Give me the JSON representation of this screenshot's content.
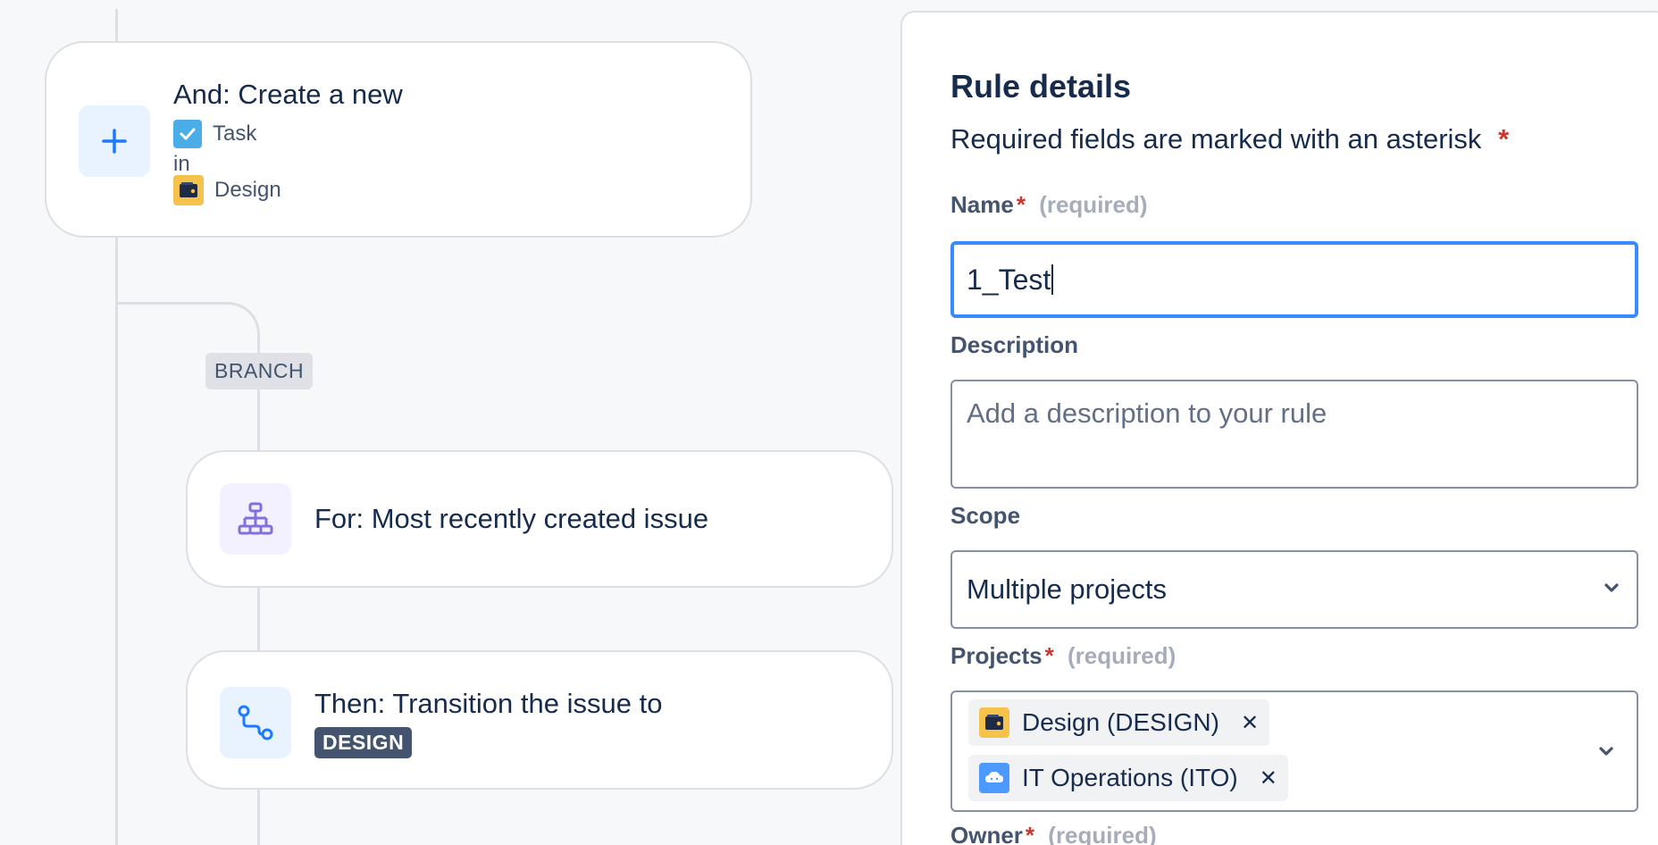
{
  "canvas": {
    "trigger_card": {
      "title": "And: Create a new",
      "issue_type": "Task",
      "in_label": "in",
      "project": "Design",
      "icon": "plus-icon"
    },
    "branch_label": "BRANCH",
    "for_card": {
      "title": "For: Most recently created issue",
      "icon": "hierarchy-icon"
    },
    "then_card": {
      "title": "Then: Transition the issue to",
      "status": "DESIGN",
      "icon": "transition-icon"
    }
  },
  "panel": {
    "title": "Rule details",
    "required_note": "Required fields are marked with an asterisk",
    "asterisk": "*",
    "name": {
      "label": "Name",
      "hint": "(required)",
      "value": "1_Test"
    },
    "description": {
      "label": "Description",
      "placeholder": "Add a description to your rule"
    },
    "scope": {
      "label": "Scope",
      "value": "Multiple projects"
    },
    "projects": {
      "label": "Projects",
      "hint": "(required)",
      "selected": [
        {
          "label": "Design (DESIGN)",
          "icon": "design-project-icon"
        },
        {
          "label": "IT Operations (ITO)",
          "icon": "it-operations-project-icon"
        }
      ]
    },
    "owner": {
      "label": "Owner",
      "hint": "(required)"
    }
  },
  "colors": {
    "accent": "#388bff",
    "required": "#c9372c",
    "text": "#172b4d",
    "subtle_text": "#44546f"
  }
}
